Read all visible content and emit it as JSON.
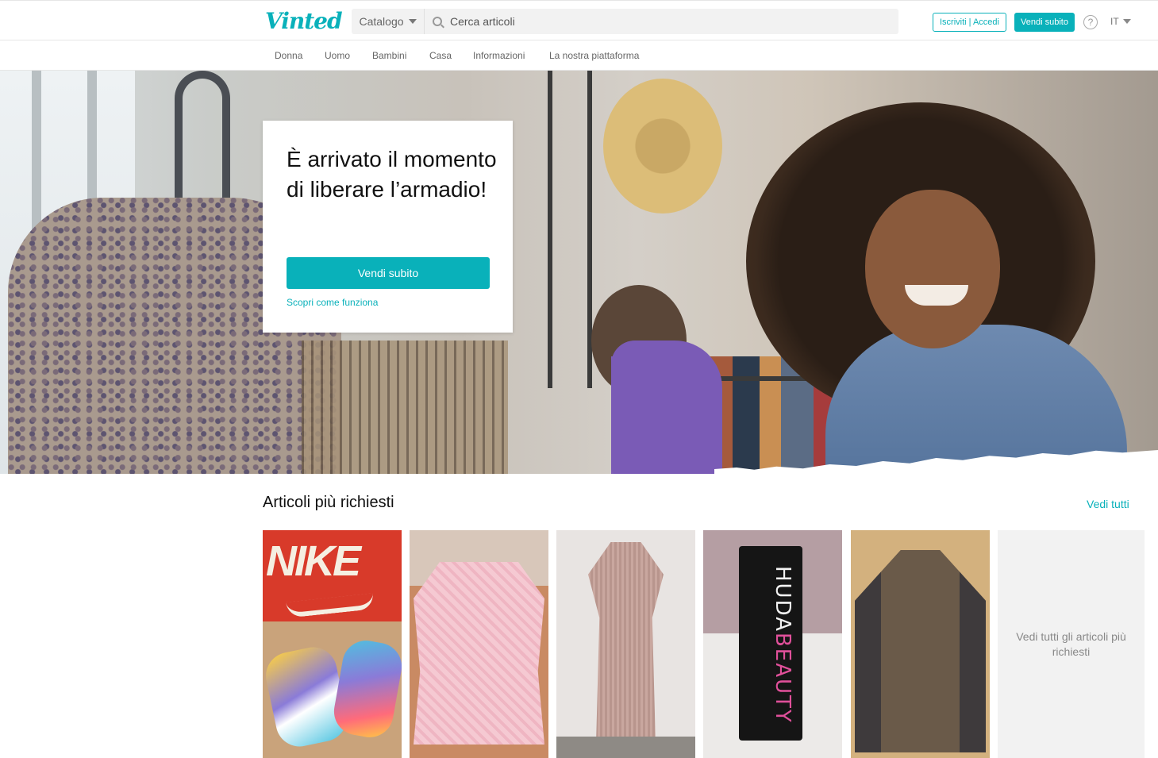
{
  "header": {
    "logo": "Vinted",
    "catalog_label": "Catalogo",
    "search_placeholder": "Cerca articoli",
    "signup_login_label": "Iscriviti | Accedi",
    "sell_label": "Vendi subito",
    "help_glyph": "?",
    "language": "IT"
  },
  "nav": {
    "items": [
      "Donna",
      "Uomo",
      "Bambini",
      "Casa",
      "Informazioni",
      "La nostra piattaforma"
    ]
  },
  "hero": {
    "headline": "È arrivato il momento di liberare l’armadio!",
    "cta_label": "Vendi subito",
    "link_label": "Scopri come funziona"
  },
  "popular": {
    "title": "Articoli più richiesti",
    "see_all_label": "Vedi tutti",
    "items": [
      {
        "name": "nike-sneakers",
        "pkg_text_1": "",
        "pkg_text_2": ""
      },
      {
        "name": "pink-fringe-top"
      },
      {
        "name": "lace-dress"
      },
      {
        "name": "huda-beauty-foundation",
        "pkg_text_1": "HUDA",
        "pkg_text_2": "BEAUTY"
      },
      {
        "name": "nike-jacket"
      }
    ],
    "nike_box_text": "NIKE",
    "see_all_tile_label": "Vedi tutti gli articoli più richiesti"
  },
  "colors": {
    "brand": "#09b1ba"
  }
}
